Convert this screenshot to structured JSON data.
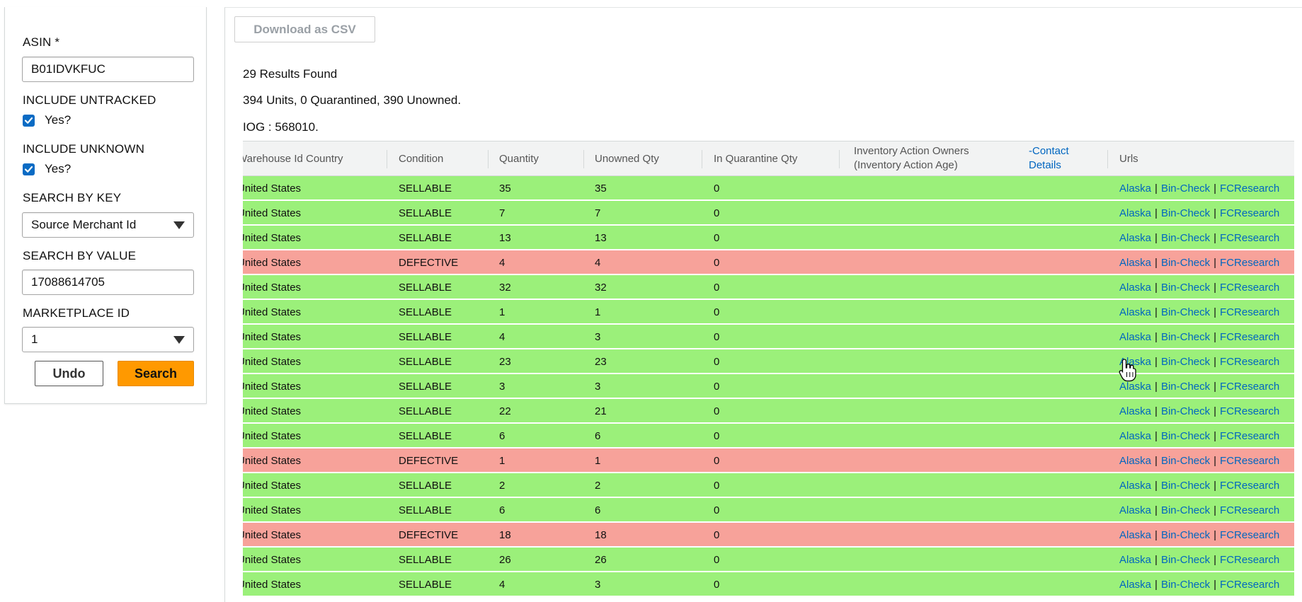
{
  "form": {
    "asin_label": "ASIN *",
    "asin_value": "B01IDVKFUC",
    "include_untracked_label": "INCLUDE UNTRACKED",
    "include_untracked_check": "Yes?",
    "include_unknown_label": "INCLUDE UNKNOWN",
    "include_unknown_check": "Yes?",
    "search_by_key_label": "SEARCH BY KEY",
    "search_by_key_value": "Source Merchant Id",
    "search_by_value_label": "SEARCH BY VALUE",
    "search_by_value_value": "17088614705",
    "marketplace_label": "MARKETPLACE ID",
    "marketplace_value": "1",
    "undo_label": "Undo",
    "search_label": "Search"
  },
  "results": {
    "csv_label": "Download as CSV",
    "found": "29 Results Found",
    "units": "394 Units, 0 Quarantined, 390 Unowned.",
    "iog": "IOG : 568010."
  },
  "table": {
    "headers": {
      "country": "Warehouse Id Country",
      "condition": "Condition",
      "quantity": "Quantity",
      "unowned": "Unowned Qty",
      "quarantine": "In Quarantine Qty",
      "owners_line1": "Inventory Action Owners",
      "owners_line2": "(Inventory Action Age)",
      "contact_line1": "-Contact",
      "contact_line2": "Details",
      "urls": "Urls"
    },
    "link_labels": [
      "Alaska",
      "Bin-Check",
      "FCResearch"
    ],
    "rows": [
      {
        "country": "United States",
        "condition": "SELLABLE",
        "quantity": "35",
        "unowned": "35",
        "quarantine": "0",
        "status": "ok"
      },
      {
        "country": "United States",
        "condition": "SELLABLE",
        "quantity": "7",
        "unowned": "7",
        "quarantine": "0",
        "status": "ok"
      },
      {
        "country": "United States",
        "condition": "SELLABLE",
        "quantity": "13",
        "unowned": "13",
        "quarantine": "0",
        "status": "ok"
      },
      {
        "country": "United States",
        "condition": "DEFECTIVE",
        "quantity": "4",
        "unowned": "4",
        "quarantine": "0",
        "status": "bad"
      },
      {
        "country": "United States",
        "condition": "SELLABLE",
        "quantity": "32",
        "unowned": "32",
        "quarantine": "0",
        "status": "ok"
      },
      {
        "country": "United States",
        "condition": "SELLABLE",
        "quantity": "1",
        "unowned": "1",
        "quarantine": "0",
        "status": "ok"
      },
      {
        "country": "United States",
        "condition": "SELLABLE",
        "quantity": "4",
        "unowned": "3",
        "quarantine": "0",
        "status": "ok"
      },
      {
        "country": "United States",
        "condition": "SELLABLE",
        "quantity": "23",
        "unowned": "23",
        "quarantine": "0",
        "status": "ok"
      },
      {
        "country": "United States",
        "condition": "SELLABLE",
        "quantity": "3",
        "unowned": "3",
        "quarantine": "0",
        "status": "ok"
      },
      {
        "country": "United States",
        "condition": "SELLABLE",
        "quantity": "22",
        "unowned": "21",
        "quarantine": "0",
        "status": "ok"
      },
      {
        "country": "United States",
        "condition": "SELLABLE",
        "quantity": "6",
        "unowned": "6",
        "quarantine": "0",
        "status": "ok"
      },
      {
        "country": "United States",
        "condition": "DEFECTIVE",
        "quantity": "1",
        "unowned": "1",
        "quarantine": "0",
        "status": "bad"
      },
      {
        "country": "United States",
        "condition": "SELLABLE",
        "quantity": "2",
        "unowned": "2",
        "quarantine": "0",
        "status": "ok"
      },
      {
        "country": "United States",
        "condition": "SELLABLE",
        "quantity": "6",
        "unowned": "6",
        "quarantine": "0",
        "status": "ok"
      },
      {
        "country": "United States",
        "condition": "DEFECTIVE",
        "quantity": "18",
        "unowned": "18",
        "quarantine": "0",
        "status": "bad"
      },
      {
        "country": "United States",
        "condition": "SELLABLE",
        "quantity": "26",
        "unowned": "26",
        "quarantine": "0",
        "status": "ok"
      },
      {
        "country": "United States",
        "condition": "SELLABLE",
        "quantity": "4",
        "unowned": "3",
        "quarantine": "0",
        "status": "ok"
      }
    ]
  },
  "colors": {
    "sellable_row": "#9bf07a",
    "defective_row": "#f7a29a",
    "link": "#0066c0",
    "search_button": "#ff9900",
    "checkbox": "#0a6bc4"
  },
  "icons": {
    "checkbox": "check-icon",
    "select": "caret-down-icon",
    "cursor": "hand-pointer-icon"
  }
}
